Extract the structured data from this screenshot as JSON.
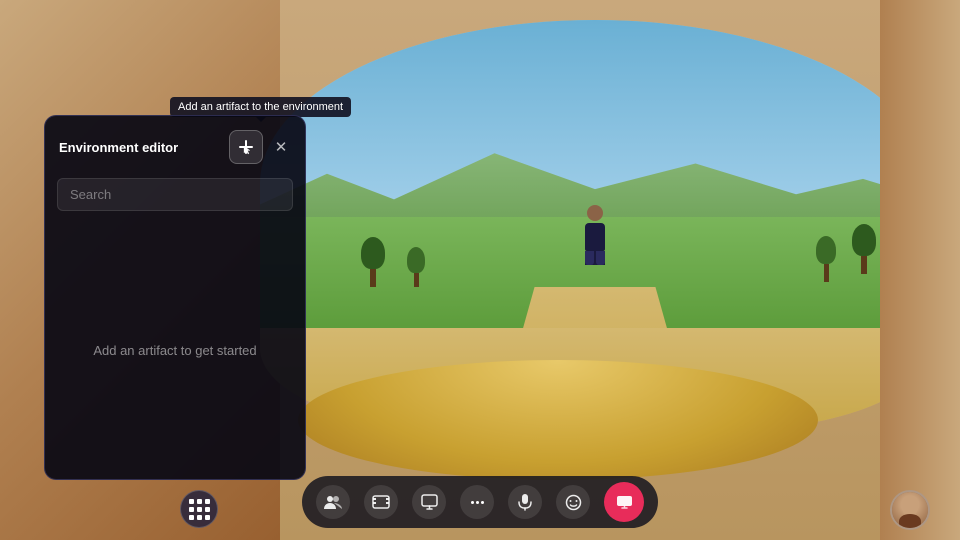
{
  "scene": {
    "bg_color": "#c9a87c"
  },
  "tooltip": {
    "text": "Add an artifact to the environment"
  },
  "env_panel": {
    "title": "Environment editor",
    "search_placeholder": "Search",
    "empty_state": "Add an artifact to get started",
    "add_button_label": "+",
    "close_button_label": "✕"
  },
  "toolbar": {
    "apps_icon": "apps-grid",
    "people_icon": "👥",
    "film_icon": "🎬",
    "present_icon": "📋",
    "more_icon": "...",
    "mic_icon": "🎤",
    "emoji_icon": "😊",
    "screen_icon": "⬛",
    "user_avatar_alt": "User avatar"
  }
}
